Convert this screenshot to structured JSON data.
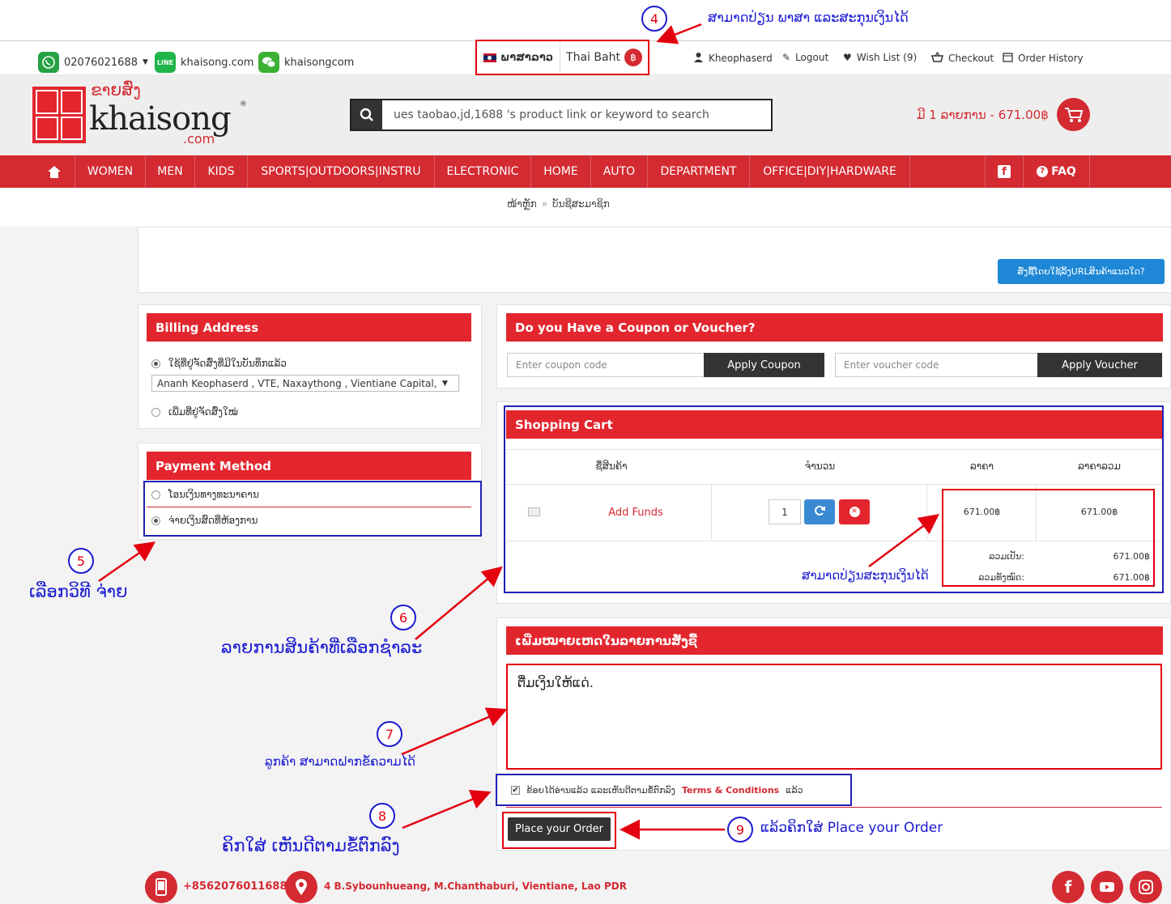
{
  "topbar": {
    "phone": "02076021688",
    "line_id": "khaisong.com",
    "wechat_id": "khaisongcom",
    "language": "ພາສາລາວ",
    "currency": "Thai Baht",
    "currency_symbol": "฿",
    "user": "Kheophaserd",
    "logout": "Logout",
    "wishlist": "Wish List (9)",
    "checkout": "Checkout",
    "order_history": "Order History"
  },
  "header": {
    "logo_lao": "ຂາຍສົ່ງ",
    "logo_main": "khaisong",
    "logo_domain": ".com",
    "logo_reg": "®",
    "search_placeholder": "ues taobao,jd,1688 's product link or keyword to search",
    "cart_summary": "ມີ 1 ລາຍການ - 671.00฿"
  },
  "nav": {
    "items": [
      "WOMEN",
      "MEN",
      "KIDS",
      "SPORTS|OUTDOORS|INSTRU",
      "ELECTRONIC",
      "HOME",
      "AUTO",
      "DEPARTMENT",
      "OFFICE|DIY|HARDWARE"
    ],
    "faq": "FAQ"
  },
  "breadcrumb": {
    "home": "ໜ້າຫຼັກ",
    "sep": "»",
    "current": "ບັນຊີສະມາຊິກ"
  },
  "help_button": "ສັ່ງຊື້ໂດຍໃຊ້ລິ້ງURLສິນຄ້າແນວໃດ?",
  "billing": {
    "title": "Billing Address",
    "option_existing": "ໃຊ້ທີ່ຢູ່ຈັດສົ່ງທີ່ມີໃນບັນທຶກແລ້ວ",
    "address_selected": "Ananh Keophaserd , VTE, Naxaythong , Vientiane Capital, Lao",
    "option_new": "ເພີ່ມທີ່ຢູ່ຈັດສົ່ງໃໝ່"
  },
  "payment": {
    "title": "Payment Method",
    "option_bank": "ໂອນເງິນທາງທະນາຄານ",
    "option_office": "ຈ່າຍເງິນສົດທີ່ຫ້ອງການ"
  },
  "coupon": {
    "title": "Do you Have a Coupon or Voucher?",
    "coupon_placeholder": "Enter coupon code",
    "apply_coupon": "Apply Coupon",
    "voucher_placeholder": "Enter voucher code",
    "apply_voucher": "Apply Voucher"
  },
  "cart": {
    "title": "Shopping Cart",
    "col_name": "ຊື່ສິນຄ້າ",
    "col_qty": "ຈຳນວນ",
    "col_price": "ລາຄາ",
    "col_total": "ລາຄາລວມ",
    "item_name": "Add Funds",
    "item_qty": "1",
    "item_price": "671.00฿",
    "item_total": "671.00฿",
    "subtotal_label": "ລວມເປັນ:",
    "subtotal_value": "671.00฿",
    "grand_label": "ລວມທັງໝົດ:",
    "grand_value": "671.00฿"
  },
  "notes": {
    "title": "ເພີ່ມໝາຍເຫດໃນລາຍການສັ່ງຊື້",
    "text": "ຕື່ມເງິນໃຫ້ແດ່."
  },
  "terms": {
    "prefix": "ຂ້ອຍໄດ້ອ່ານແລ້ວ ແລະເຫັນດີຕາມຂໍ້ຕົກລົງ",
    "link": "Terms & Conditions",
    "suffix": "ແລ້ວ"
  },
  "place_order": "Place your Order",
  "footer": {
    "phone": "+8562076011688",
    "address": "4 B.Sybounhueang, M.Chanthaburi, Vientiane, Lao PDR"
  },
  "annotations": {
    "n4": "4",
    "t4": "ສາມາດປ່ຽນ ພາສາ ແລະສະກຸນເງິນໄດ້",
    "n5": "5",
    "t5": "ເລືອກວິທີ ຈ່າຍ",
    "n6": "6",
    "t6": "ລາຍການສິນຄ້າທີ່ເລືອກຊຳລະ",
    "t6b": "ສາມາດປ່ຽນສະກຸນເງິນໄດ້",
    "n7": "7",
    "t7": "ລູກຄ້າ ສາມາດຝາກຂໍ້ຄວາມໄດ້",
    "n8": "8",
    "t8": "ຄິກໃສ່ ເຫັນດີຕາມຂໍ້ຕົກລົງ",
    "n9": "9",
    "t9": "ແລ້ວຄິກໃສ່  Place your Order"
  },
  "colors": {
    "brand_red": "#d42a32",
    "header_red": "#e3262e",
    "annotation_blue": "#1a1ad1",
    "annotation_red": "#e3000f"
  }
}
